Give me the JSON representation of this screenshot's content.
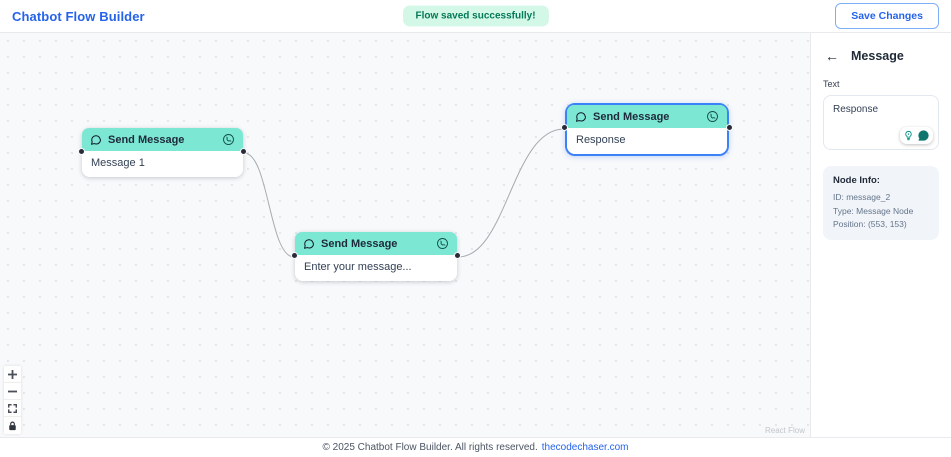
{
  "header": {
    "title": "Chatbot Flow Builder",
    "toast": "Flow saved successfully!",
    "save_button": "Save Changes"
  },
  "canvas": {
    "attribution": "React Flow",
    "nodes": [
      {
        "header": "Send Message",
        "body": "Message 1",
        "selected": false
      },
      {
        "header": "Send Message",
        "body": "Enter your message...",
        "selected": false
      },
      {
        "header": "Send Message",
        "body": "Response",
        "selected": true
      }
    ],
    "edges": [
      {
        "from": "node-1",
        "to": "node-2"
      },
      {
        "from": "node-2",
        "to": "node-3"
      }
    ],
    "controls": [
      "zoom-in",
      "zoom-out",
      "fit-view",
      "lock"
    ]
  },
  "sidebar": {
    "back_icon": "←",
    "title": "Message",
    "text_label": "Text",
    "textarea_value": "Response",
    "node_info": {
      "heading": "Node Info:",
      "id": "ID: message_2",
      "type": "Type: Message Node",
      "position": "Position: (553, 153)"
    }
  },
  "footer": {
    "copyright": "© 2025 Chatbot Flow Builder. All rights reserved.",
    "link": "thecodechaser.com"
  },
  "colors": {
    "accent_blue": "#2563eb",
    "selected_border": "#3b82f6",
    "node_header_teal": "#7ce8d3",
    "toast_bg": "#d4f8e8",
    "toast_text": "#047857",
    "edge_gray": "#a8aab0",
    "canvas_bg": "#f8f9fb"
  }
}
